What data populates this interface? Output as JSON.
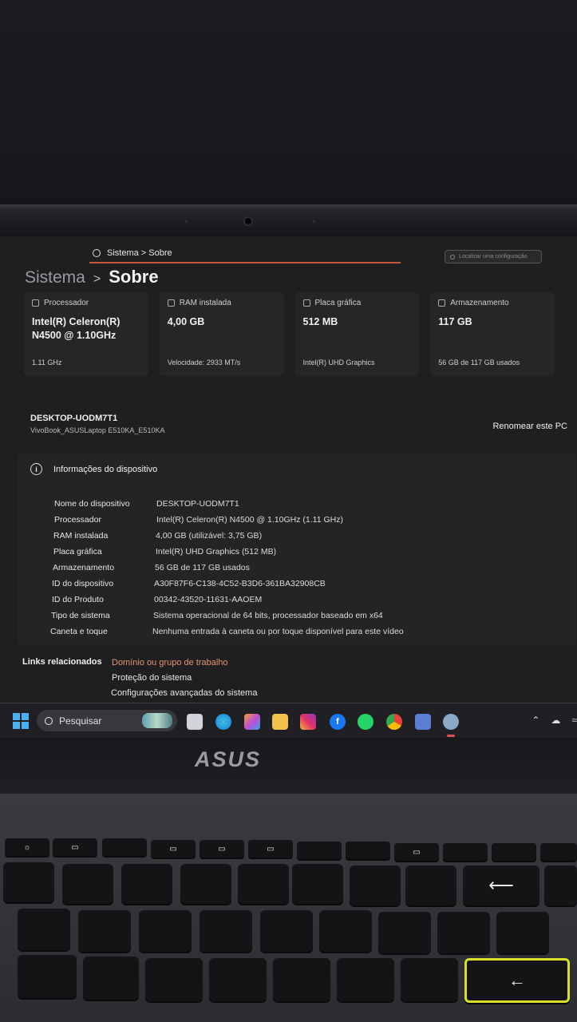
{
  "search": {
    "text": "Sistema > Sobre",
    "placeholder": "Localizar uma configuração"
  },
  "breadcrumb": {
    "parent": "Sistema",
    "separator": ">",
    "current": "Sobre"
  },
  "cards": [
    {
      "title": "Processador",
      "value": "Intel(R) Celeron(R) N4500 @ 1.10GHz",
      "footer": "1.11 GHz",
      "icon": "processor-icon"
    },
    {
      "title": "RAM instalada",
      "value": "4,00 GB",
      "footer": "Velocidade: 2933 MT/s",
      "icon": "ram-icon"
    },
    {
      "title": "Placa gráfica",
      "value": "512 MB",
      "footer": "Intel(R) UHD Graphics",
      "icon": "graphics-icon"
    },
    {
      "title": "Armazenamento",
      "value": "117 GB",
      "footer": "56 GB de 117 GB usados",
      "icon": "storage-icon"
    }
  ],
  "pc": {
    "name": "DESKTOP-UODM7T1",
    "model": "VivoBook_ASUSLaptop E510KA_E510KA",
    "rename_label": "Renomear este PC"
  },
  "device_info": {
    "title": "Informações do dispositivo",
    "rows": [
      {
        "label": "Nome do dispositivo",
        "value": "DESKTOP-UODM7T1"
      },
      {
        "label": "Processador",
        "value": "Intel(R) Celeron(R) N4500 @ 1.10GHz (1.11 GHz)"
      },
      {
        "label": "RAM instalada",
        "value": "4,00 GB (utilizável: 3,75 GB)"
      },
      {
        "label": "Placa gráfica",
        "value": "Intel(R) UHD Graphics (512 MB)"
      },
      {
        "label": "Armazenamento",
        "value": "56 GB de 117 GB usados"
      },
      {
        "label": "ID do dispositivo",
        "value": "A30F87F6-C138-4C52-B3D6-361BA32908CB"
      },
      {
        "label": "ID do Produto",
        "value": "00342-43520-11631-AAOEM"
      },
      {
        "label": "Tipo de sistema",
        "value": "Sistema operacional de 64 bits, processador baseado em x64"
      },
      {
        "label": "Caneta e toque",
        "value": "Nenhuma entrada à caneta ou por toque disponível para este vídeo"
      }
    ]
  },
  "related_links": {
    "title": "Links relacionados",
    "items": [
      "Domínio ou grupo de trabalho",
      "Proteção do sistema",
      "Configurações avançadas do sistema"
    ]
  },
  "taskbar": {
    "search_label": "Pesquisar"
  },
  "hardware": {
    "brand": "ASUS"
  },
  "colors": {
    "accent": "#c2573c",
    "link_accent": "#e3946f",
    "start_blue": "#4ab0f0",
    "enter_key_highlight": "#d8e02a"
  }
}
